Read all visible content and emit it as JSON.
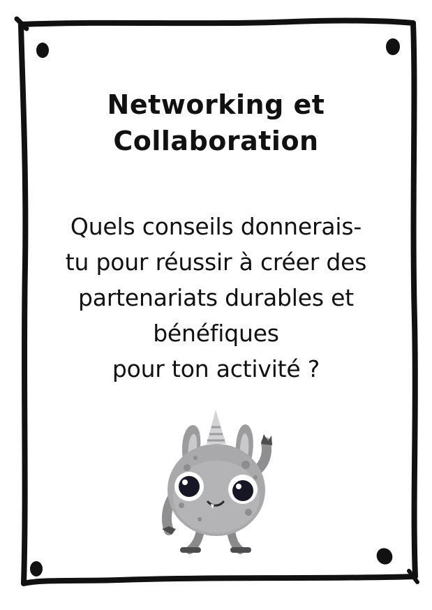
{
  "card": {
    "title_lines": [
      "Networking et",
      "Collaboration"
    ],
    "question_lines": [
      "Quels conseils donnerais-",
      "tu pour réussir à créer des",
      "partenariats durables et",
      "bénéfiques",
      "pour ton activité ?"
    ],
    "mascot_icon": "grey-horned-monster-waving",
    "colors": {
      "ink": "#111111",
      "monster_body": "#a9a9ab",
      "monster_dark": "#7f7f82",
      "background": "#ffffff"
    }
  }
}
